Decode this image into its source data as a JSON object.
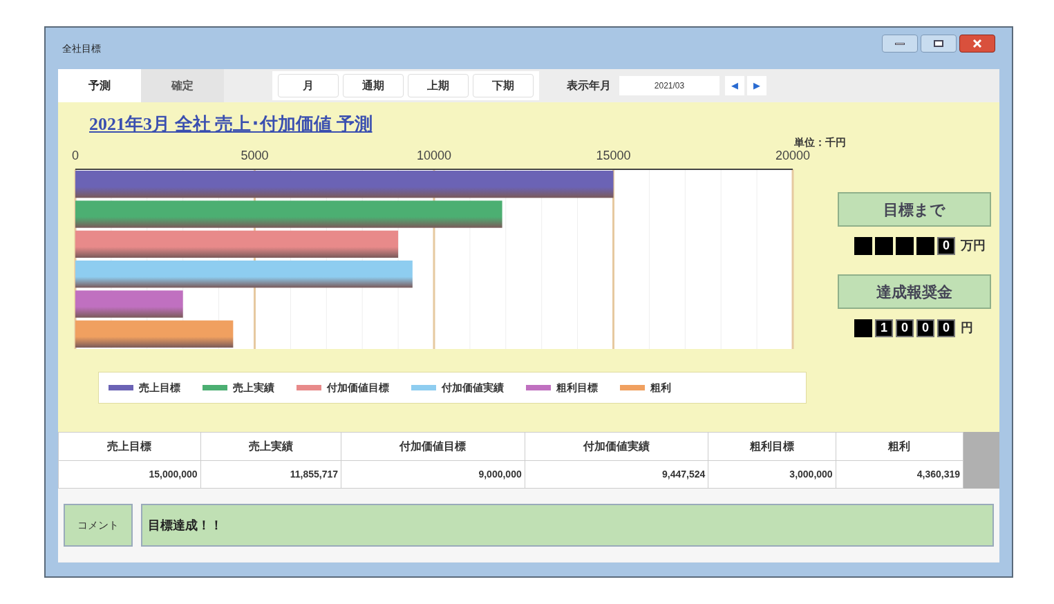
{
  "window": {
    "title": "全社目標"
  },
  "tabs": [
    {
      "label": "予測",
      "selected": true
    },
    {
      "label": "確定",
      "selected": false
    }
  ],
  "period_buttons": [
    "月",
    "通期",
    "上期",
    "下期"
  ],
  "month_picker": {
    "label": "表示年月",
    "value": "2021/03",
    "prev": "◀",
    "next": "▶"
  },
  "chart": {
    "title": "2021年3月 全社 売上･付加価値 予測",
    "unit": "単位：千円",
    "chart_data": {
      "type": "bar",
      "orientation": "horizontal",
      "grid": true,
      "xlim": [
        0,
        20000
      ],
      "xticks": [
        0,
        5000,
        10000,
        15000,
        20000
      ],
      "series": [
        {
          "name": "売上目標",
          "color": "#6b63b5",
          "values": [
            15000
          ]
        },
        {
          "name": "売上実績",
          "color": "#4caf72",
          "values": [
            11900
          ]
        },
        {
          "name": "付加価値目標",
          "color": "#e88a8a",
          "values": [
            9000
          ]
        },
        {
          "name": "付加価値実績",
          "color": "#8ecdf0",
          "values": [
            9400
          ]
        },
        {
          "name": "粗利目標",
          "color": "#c070c0",
          "values": [
            3000
          ]
        },
        {
          "name": "粗利",
          "color": "#f0a060",
          "values": [
            4400
          ]
        }
      ]
    }
  },
  "side_panel": [
    {
      "button": "目標まで",
      "digits": [
        {
          "on": false
        },
        {
          "on": false
        },
        {
          "on": false
        },
        {
          "on": false
        },
        {
          "on": true,
          "text": "0"
        }
      ],
      "unit": "万円"
    },
    {
      "button": "達成報奨金",
      "digits": [
        {
          "on": false
        },
        {
          "on": true,
          "text": "1"
        },
        {
          "on": true,
          "text": "0"
        },
        {
          "on": true,
          "text": "0"
        },
        {
          "on": true,
          "text": "0"
        }
      ],
      "unit": "円"
    }
  ],
  "table": {
    "columns": [
      "売上目標",
      "売上実績",
      "付加価値目標",
      "付加価値実績",
      "粗利目標",
      "粗利"
    ],
    "rows": [
      [
        "15,000,000",
        "11,855,717",
        "9,000,000",
        "9,447,524",
        "3,000,000",
        "4,360,319"
      ]
    ]
  },
  "comment": {
    "label": "コメント",
    "value": "目標達成！！"
  }
}
